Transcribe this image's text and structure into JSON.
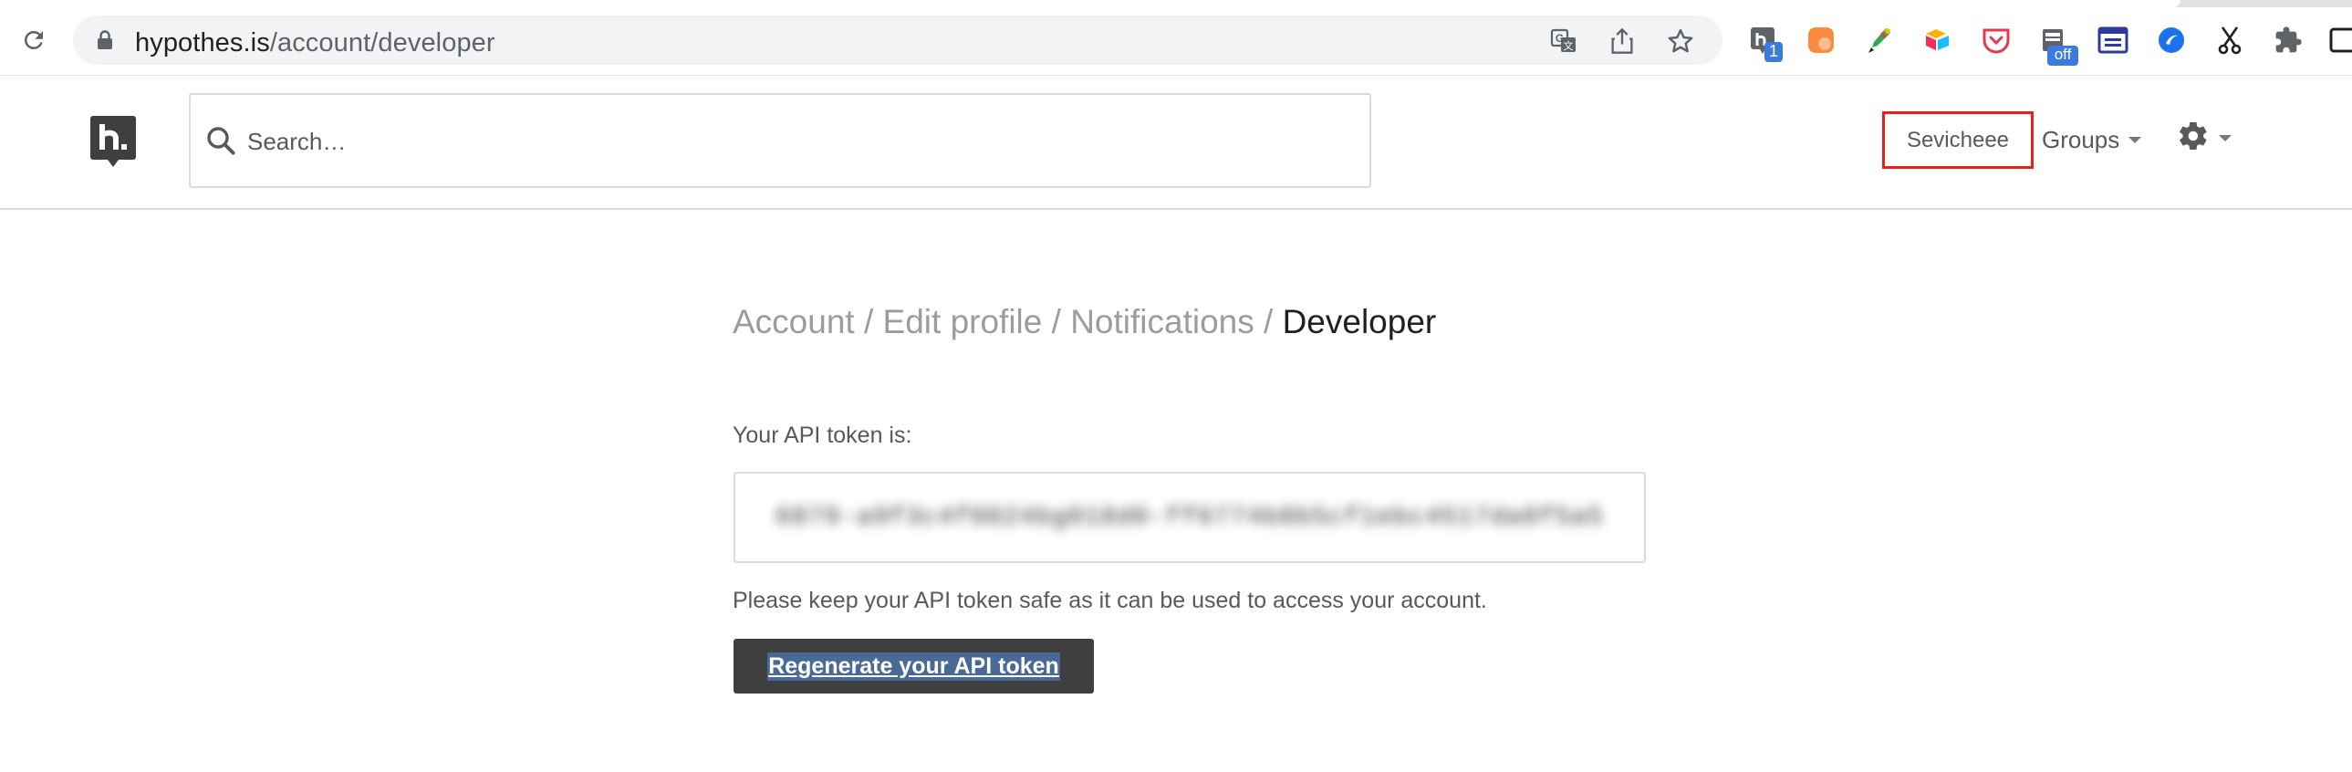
{
  "browser": {
    "url_host": "hypothes.is",
    "url_path": "/account/developer",
    "extensions": [
      {
        "name": "hypothesis-extension",
        "badge": "1",
        "badge_color": "#3b7be0"
      },
      {
        "name": "orange-extension"
      },
      {
        "name": "pen-extension"
      },
      {
        "name": "airtable-extension"
      },
      {
        "name": "pocket-extension",
        "color": "#e8384f"
      },
      {
        "name": "tab-extension",
        "badge": "off",
        "badge_color": "#3b7be0"
      },
      {
        "name": "window-extension",
        "color": "#2b3a9b"
      },
      {
        "name": "globe-extension",
        "color": "#1a73e8"
      },
      {
        "name": "scissors-extension"
      },
      {
        "name": "puzzle-extension"
      }
    ]
  },
  "header": {
    "search_placeholder": "Search…",
    "user_name": "Sevicheee",
    "groups_label": "Groups"
  },
  "breadcrumb": {
    "items": [
      "Account",
      "Edit profile",
      "Notifications"
    ],
    "separator": "/",
    "current": "Developer"
  },
  "developer": {
    "token_label": "Your API token is:",
    "token_value": "6879-a9f3c4f0024bg018d0-ff6774b8b5cf1ebc4517da8f5a5",
    "token_note": "Please keep your API token safe as it can be used to access your account.",
    "regenerate_label": "Regenerate your API token"
  },
  "colors": {
    "highlight_border": "#e32319",
    "button_bg": "#3f3f3f",
    "link_gray": "#9c9c9c"
  }
}
